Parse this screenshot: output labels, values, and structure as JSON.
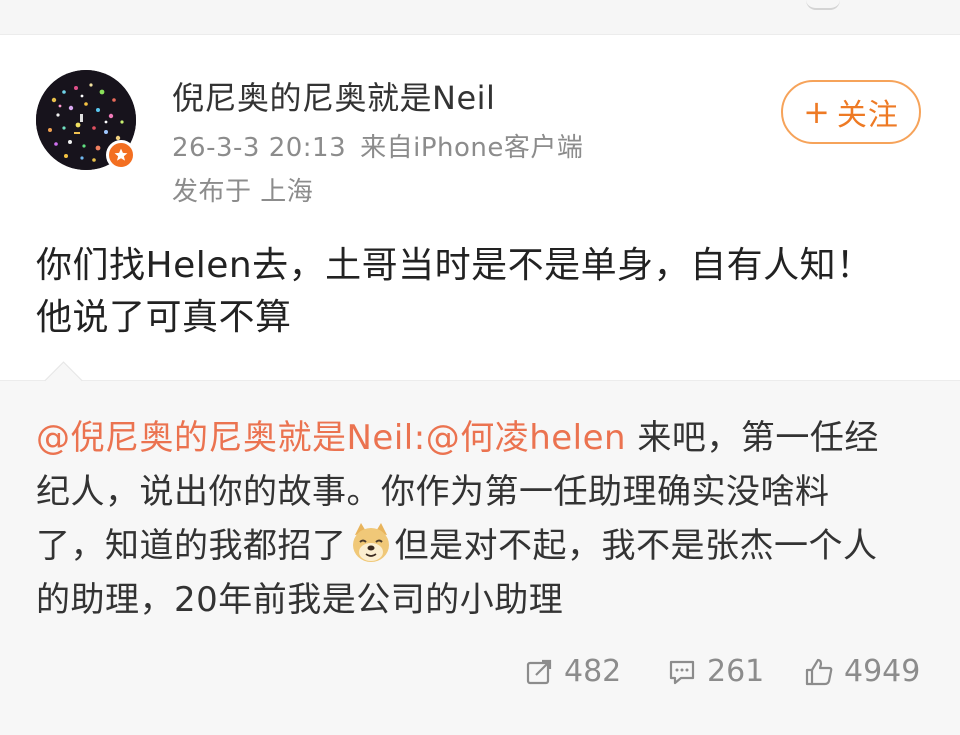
{
  "post": {
    "author": "倪尼奥的尼奥就是Neil",
    "time": "26-3-3 20:13",
    "source": "来自iPhone客户端",
    "location": "发布于 上海",
    "follow_label": "关注",
    "text_lines": [
      "你们找Helen去，土哥当时是不是单身，自有人知！",
      "他说了可真不算"
    ]
  },
  "repost": {
    "mention_author": "@倪尼奥的尼奥就是Neil:",
    "mention_user": "@何凌helen",
    "line1_rest": " 来吧，第一任经",
    "line2": "纪人，说出你的故事。你作为第一任助理确实没啥料",
    "line3_before_emoji": "了，知道的我都招了",
    "emoji_name": "doge-emoji",
    "line3_after_emoji": "但是对不起，我不是张杰一个人",
    "line4": "的助理，20年前我是公司的小助理"
  },
  "actions": {
    "reposts": "482",
    "comments": "261",
    "likes": "4949"
  },
  "icons": {
    "verified": "verified-badge-icon",
    "repost": "repost-icon",
    "comment": "comment-icon",
    "like": "thumbs-up-icon"
  },
  "colors": {
    "accent": "#ee7a24",
    "mention": "#eb7350",
    "verified_badge": "#f36f21",
    "meta_text": "#8c8c8c"
  }
}
